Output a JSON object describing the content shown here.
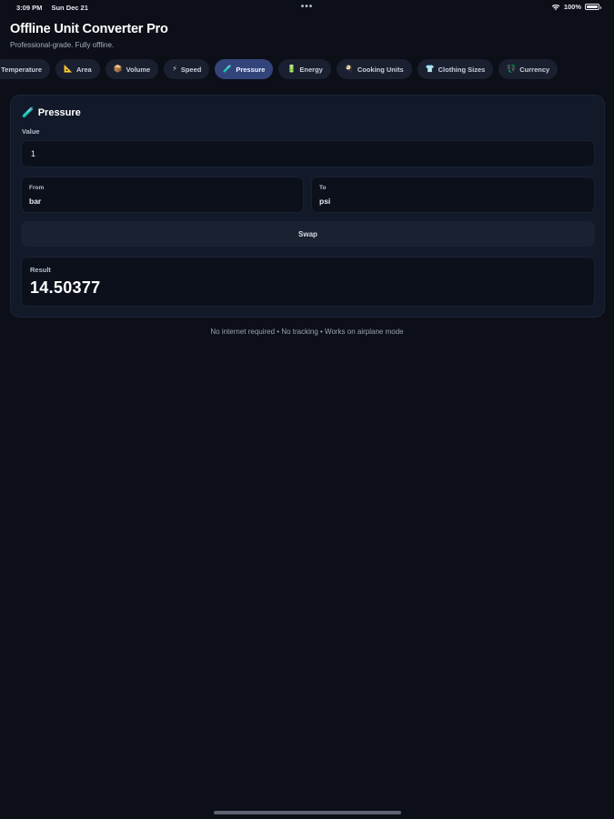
{
  "status_bar": {
    "time": "3:09 PM",
    "date": "Sun Dec 21",
    "dots": "•••",
    "battery_text": "100%"
  },
  "header": {
    "title": "Offline Unit Converter Pro",
    "subtitle": "Professional-grade. Fully offline."
  },
  "tabs": [
    {
      "icon": "🌡",
      "label": "Temperature"
    },
    {
      "icon": "📐",
      "label": "Area"
    },
    {
      "icon": "📦",
      "label": "Volume"
    },
    {
      "icon": "⚡",
      "label": "Speed"
    },
    {
      "icon": "🧪",
      "label": "Pressure"
    },
    {
      "icon": "🔋",
      "label": "Energy"
    },
    {
      "icon": "🍳",
      "label": "Cooking Units"
    },
    {
      "icon": "👕",
      "label": "Clothing Sizes"
    },
    {
      "icon": "💱",
      "label": "Currency"
    }
  ],
  "active_tab": "Pressure",
  "converter": {
    "title_icon": "🧪",
    "title": "Pressure",
    "value_label": "Value",
    "value": "1",
    "from_label": "From",
    "from_value": "bar",
    "to_label": "To",
    "to_value": "psi",
    "swap_label": "Swap",
    "result_label": "Result",
    "result_value": "14.50377"
  },
  "footer": {
    "note": "No internet required • No tracking • Works on airplane mode"
  },
  "colors": {
    "background": "#0c0f17",
    "card": "#121a2a",
    "active_tab": "#33447a",
    "tab": "#1a2030"
  }
}
